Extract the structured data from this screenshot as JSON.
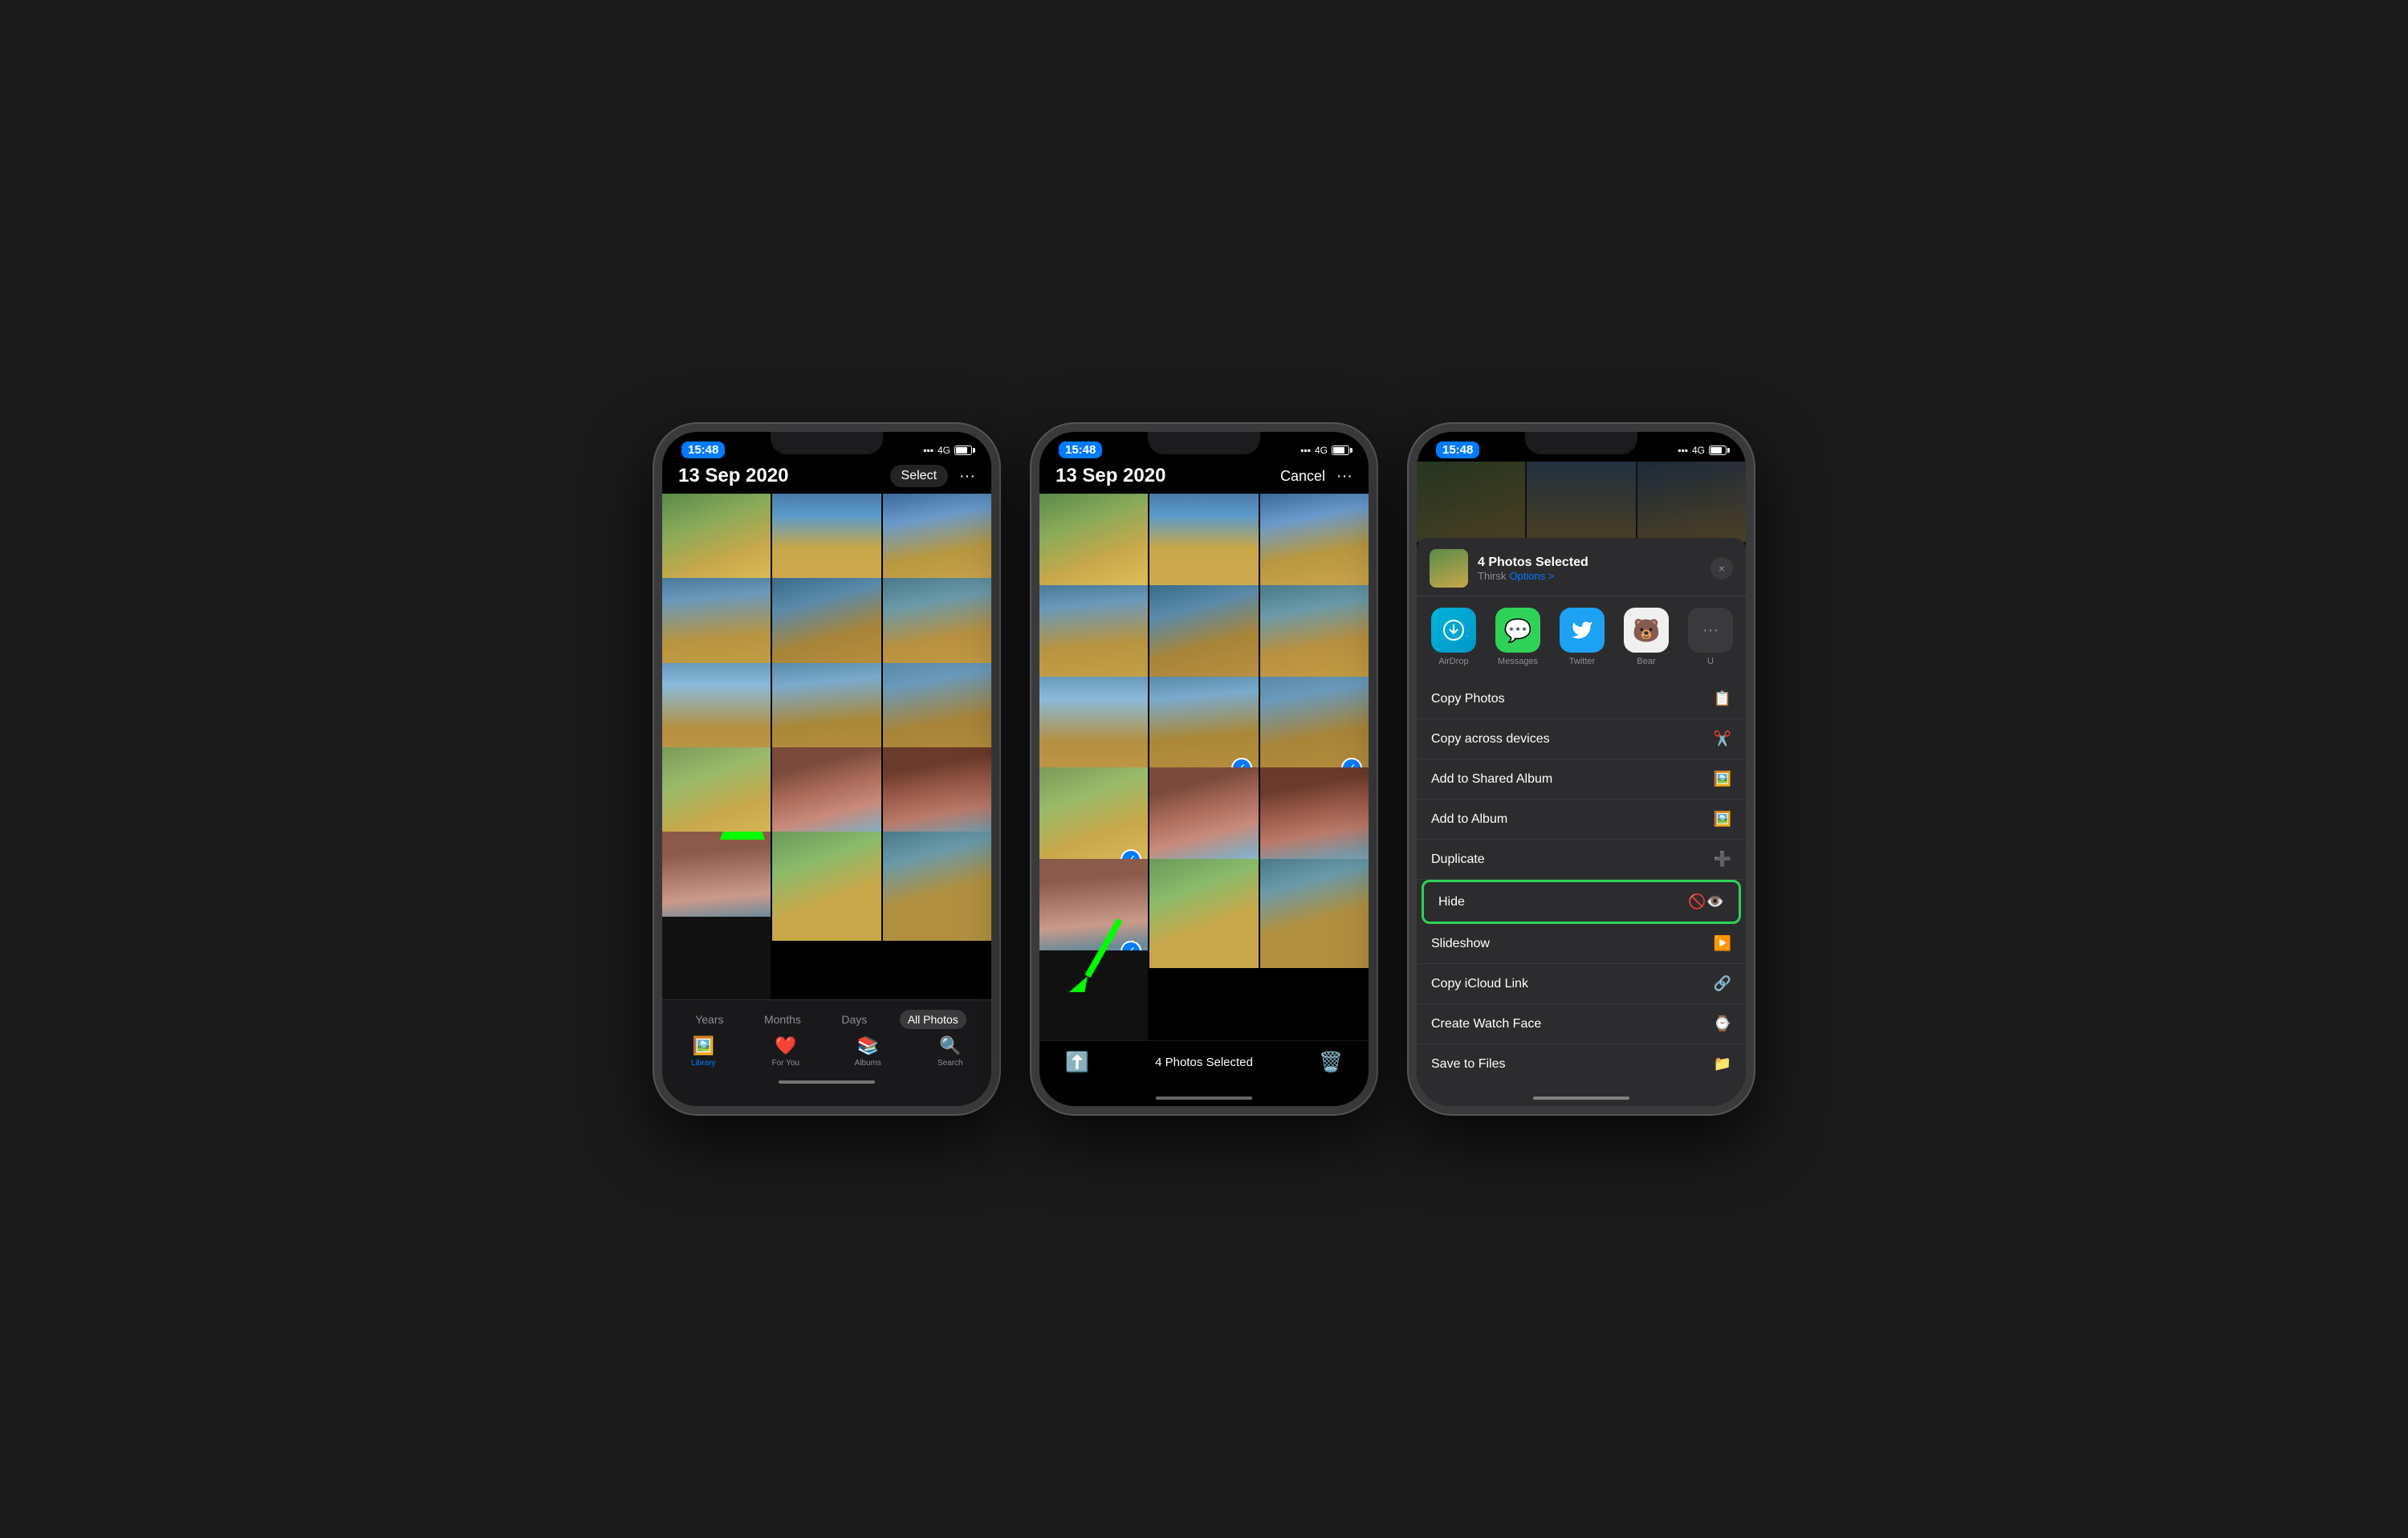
{
  "scene": {
    "background_color": "#1a1a1a"
  },
  "phone1": {
    "status": {
      "time": "15:48",
      "signal": "4G"
    },
    "header": {
      "date": "13 Sep 2020",
      "select_label": "Select",
      "more_label": "···"
    },
    "tabs": {
      "time_options": [
        "Years",
        "Months",
        "Days",
        "All Photos"
      ],
      "active_tab": "All Photos",
      "items": [
        {
          "label": "Library",
          "active": true
        },
        {
          "label": "For You",
          "active": false
        },
        {
          "label": "Albums",
          "active": false
        },
        {
          "label": "Search",
          "active": false
        }
      ]
    }
  },
  "phone2": {
    "status": {
      "time": "15:48",
      "signal": "4G"
    },
    "header": {
      "date": "13 Sep 2020",
      "cancel_label": "Cancel",
      "more_label": "···"
    },
    "share_bar": {
      "selected_text": "4 Photos Selected"
    }
  },
  "phone3": {
    "status": {
      "time": "15:48",
      "signal": "4G"
    },
    "share_sheet": {
      "title": "4 Photos Selected",
      "subtitle": "Thirsk",
      "options_label": "Options >",
      "close_label": "×",
      "apps": [
        {
          "label": "AirDrop",
          "type": "airdrop"
        },
        {
          "label": "Messages",
          "type": "messages"
        },
        {
          "label": "Twitter",
          "type": "twitter"
        },
        {
          "label": "Bear",
          "type": "bear"
        },
        {
          "label": "U",
          "type": "more"
        }
      ],
      "menu_items": [
        {
          "label": "Copy Photos",
          "icon": "📋"
        },
        {
          "label": "Copy across devices",
          "icon": "✂️"
        },
        {
          "label": "Add to Shared Album",
          "icon": "🖼️"
        },
        {
          "label": "Add to Album",
          "icon": "🖼️"
        },
        {
          "label": "Duplicate",
          "icon": "➕"
        },
        {
          "label": "Hide",
          "icon": "👁️",
          "highlighted": true
        },
        {
          "label": "Slideshow",
          "icon": "▶️"
        },
        {
          "label": "Copy iCloud Link",
          "icon": "🔗"
        },
        {
          "label": "Create Watch Face",
          "icon": "⌚"
        },
        {
          "label": "Save to Files",
          "icon": "📁"
        }
      ]
    }
  }
}
